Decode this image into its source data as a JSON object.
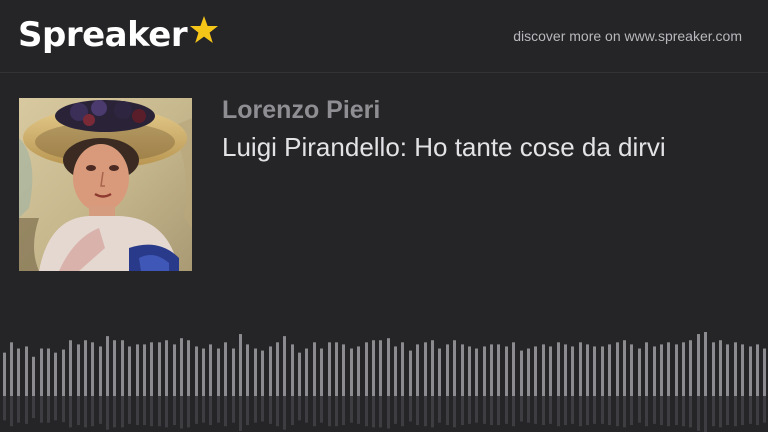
{
  "brand": {
    "name": "Spreaker",
    "tagline": "discover more on www.spreaker.com",
    "accent_color": "#f5c518"
  },
  "episode": {
    "author": "Lorenzo Pieri",
    "title": "Luigi Pirandello: Ho tante cose da dirvi",
    "cover_icon": "painting-portrait-woman-hat"
  },
  "waveform": {
    "bar_color": "#8c8c90",
    "levels": [
      0.42,
      0.52,
      0.46,
      0.48,
      0.38,
      0.46,
      0.46,
      0.42,
      0.45,
      0.54,
      0.5,
      0.54,
      0.52,
      0.48,
      0.58,
      0.54,
      0.54,
      0.48,
      0.5,
      0.5,
      0.52,
      0.52,
      0.54,
      0.5,
      0.56,
      0.54,
      0.48,
      0.46,
      0.5,
      0.46,
      0.52,
      0.46,
      0.6,
      0.5,
      0.46,
      0.44,
      0.48,
      0.52,
      0.58,
      0.5,
      0.42,
      0.46,
      0.52,
      0.46,
      0.52,
      0.52,
      0.5,
      0.46,
      0.48,
      0.52,
      0.54,
      0.54,
      0.56,
      0.48,
      0.52,
      0.44,
      0.5,
      0.52,
      0.54,
      0.46,
      0.5,
      0.54,
      0.5,
      0.48,
      0.46,
      0.48,
      0.5,
      0.5,
      0.48,
      0.52,
      0.44,
      0.46,
      0.48,
      0.5,
      0.48,
      0.52,
      0.5,
      0.48,
      0.52,
      0.5,
      0.48,
      0.48,
      0.5,
      0.52,
      0.54,
      0.5,
      0.46,
      0.52,
      0.48,
      0.5,
      0.52,
      0.5,
      0.52,
      0.54,
      0.6,
      0.62,
      0.52,
      0.54,
      0.5,
      0.52,
      0.5,
      0.48,
      0.5,
      0.46
    ]
  }
}
